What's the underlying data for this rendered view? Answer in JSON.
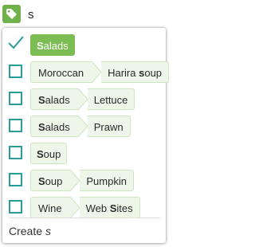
{
  "search": {
    "value": "s",
    "icon": "tag-icon",
    "accent": "#6fb24b"
  },
  "results": [
    {
      "checked": true,
      "parts": [
        "Salads"
      ],
      "selected": true
    },
    {
      "checked": false,
      "parts": [
        "Moroccan",
        "Harira soup"
      ]
    },
    {
      "checked": false,
      "parts": [
        "Salads",
        "Lettuce"
      ]
    },
    {
      "checked": false,
      "parts": [
        "Salads",
        "Prawn"
      ]
    },
    {
      "checked": false,
      "parts": [
        "Soup"
      ]
    },
    {
      "checked": false,
      "parts": [
        "Soup",
        "Pumpkin"
      ]
    },
    {
      "checked": false,
      "parts": [
        "Wine",
        "Web Sites"
      ]
    }
  ],
  "create": {
    "label": "Create",
    "query": "s"
  },
  "colors": {
    "checkbox_border": "#2a9d9a",
    "selected_pill": "#7bbd52",
    "pill_bg": "#eef6e9",
    "pill_border": "#cfe5c2"
  }
}
